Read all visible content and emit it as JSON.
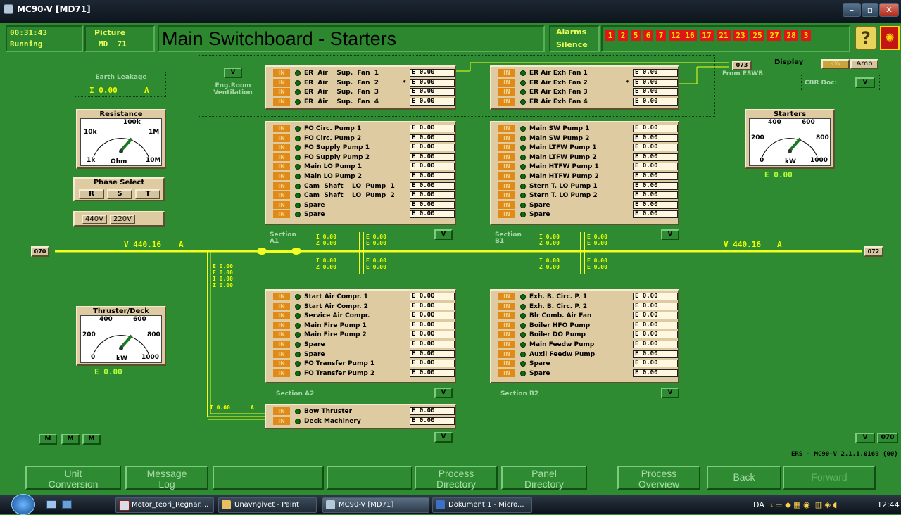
{
  "window": {
    "title": "MC90-V [MD71]"
  },
  "header": {
    "time": "00:31:43",
    "state": "Running",
    "picture_label": "Picture",
    "picture_id": "MD  71",
    "title": "Main Switchboard - Starters",
    "alarms_label": "Alarms",
    "silence_label": "Silence",
    "alarm_numbers": [
      "1",
      "2",
      "5",
      "6",
      "7",
      "12",
      "16",
      "17",
      "21",
      "23",
      "25",
      "27",
      "28",
      "3"
    ]
  },
  "left": {
    "earth_leakage_label": "Earth Leakage",
    "earth_leakage_value": "I  0.00",
    "earth_leakage_unit": "A",
    "resistance": {
      "title": "Resistance",
      "labels": [
        "100k",
        "10k",
        "1M",
        "1k",
        "Ohm",
        "10M"
      ]
    },
    "phase_select": {
      "title": "Phase Select",
      "buttons": [
        "R",
        "S",
        "T"
      ]
    },
    "voltage_buttons": [
      "440V",
      "220V"
    ],
    "thruster": {
      "title": "Thruster/Deck",
      "labels": [
        "400",
        "600",
        "200",
        "800",
        "0",
        "kW",
        "1000"
      ],
      "value": "E  0.00"
    }
  },
  "right": {
    "display_label": "Display",
    "kw_label": "kW",
    "amp_label": "Amp",
    "cbr_label": "CBR Doc:",
    "v_label": "V",
    "starters": {
      "title": "Starters",
      "labels": [
        "400",
        "600",
        "200",
        "800",
        "0",
        "kW",
        "1000"
      ],
      "value": "E  0.00"
    }
  },
  "bus": {
    "left_node": "070",
    "right_node": "072",
    "esw_node": "073",
    "esw_label": "From ESWB",
    "left_voltage": "V  440.16",
    "right_voltage": "V  440.16",
    "amp_unit": "A",
    "drop_values": [
      "E 0.00",
      "E 0.00",
      "I 0.00",
      "Z 0.00"
    ],
    "bow_current": "I 0.00",
    "bow_unit": "A"
  },
  "eng_room": {
    "v_label": "V",
    "label1": "Eng.Room",
    "label2": "Ventilation"
  },
  "in_label": "IN",
  "val_default": "E 0.00",
  "panels": {
    "sup_fans": [
      "ER  Air    Sup.  Fan  1",
      "ER  Air    Sup.  Fan  2",
      "ER  Air    Sup.  Fan  3",
      "ER  Air    Sup.  Fan  4"
    ],
    "exh_fans": [
      "ER Air Exh Fan 1",
      "ER Air Exh Fan 2",
      "ER Air Exh Fan 3",
      "ER Air Exh Fan 4"
    ],
    "a1": [
      "FO Circ. Pump 1",
      "FO Circ. Pump 2",
      "FO Supply Pump 1",
      "FO Supply Pump 2",
      "Main LO Pump 1",
      "Main LO Pump 2",
      "Cam  Shaft    LO  Pump  1",
      "Cam  Shaft    LO  Pump  2",
      "Spare",
      "Spare"
    ],
    "b1": [
      "Main SW Pump 1",
      "Main SW Pump 2",
      "Main LTFW Pump 1",
      "Main LTFW Pump 2",
      "Main HTFW Pump 1",
      "Main HTFW Pump 2",
      "Stern T. LO Pump 1",
      "Stern T. LO Pump 2",
      "Spare",
      "Spare"
    ],
    "a2": [
      "Start Air Compr. 1",
      "Start Air Compr. 2",
      "Service Air Compr.",
      "Main Fire Pump 1",
      "Main Fire Pump 2",
      "Spare",
      "Spare",
      "FO Transfer Pump 1",
      "FO Transfer Pump 2"
    ],
    "b2": [
      "Exh. B. Circ. P. 1",
      "Exh. B. Circ. P. 2",
      "Blr Comb. Air Fan",
      "Boiler HFO Pump",
      "Boiler DO Pump",
      "Main Feedw Pump",
      "Auxil Feedw Pump",
      "Spare",
      "Spare"
    ],
    "bow": [
      "Bow Thruster",
      "Deck Machinery"
    ]
  },
  "sections": {
    "a1": "Section\nA1",
    "b1": "Section\nB1",
    "a2": "Section A2",
    "b2": "Section B2",
    "a1_i": "I 0.00",
    "a1_z": "Z 0.00",
    "a1_e1": "E 0.00",
    "a1_e2": "E 0.00",
    "b1_i": "I 0.00",
    "b1_z": "Z 0.00",
    "b1_e1": "E 0.00",
    "b1_e2": "E 0.00",
    "a1_i2": "I 0.00",
    "a1_z2": "Z 0.00",
    "a1_e3": "E 0.00",
    "a1_e4": "E 0.00",
    "b1_i2": "I 0.00",
    "b1_z2": "Z 0.00",
    "b1_e3": "E 0.00",
    "b1_e4": "E 0.00"
  },
  "footer": {
    "m_buttons": [
      "M",
      "M",
      "M"
    ],
    "v_label": "V",
    "node": "070",
    "version": "ERS - MC90-V 2.1.1.0169 (00)"
  },
  "nav": [
    {
      "label": "Unit\nConversion"
    },
    {
      "label": "Message\nLog"
    },
    {
      "label": ""
    },
    {
      "label": ""
    },
    {
      "label": "Process\nDirectory"
    },
    {
      "label": "Panel\nDirectory"
    },
    {
      "label": "Process\nOverview"
    },
    {
      "label": "Back"
    },
    {
      "label": "Forward"
    }
  ],
  "taskbar": {
    "items": [
      "Motor_teori_Regnar....",
      "Unavngivet - Paint",
      "MC90-V [MD71]",
      "Dokument 1 - Micro..."
    ],
    "lang": "DA",
    "clock": "12:44"
  }
}
